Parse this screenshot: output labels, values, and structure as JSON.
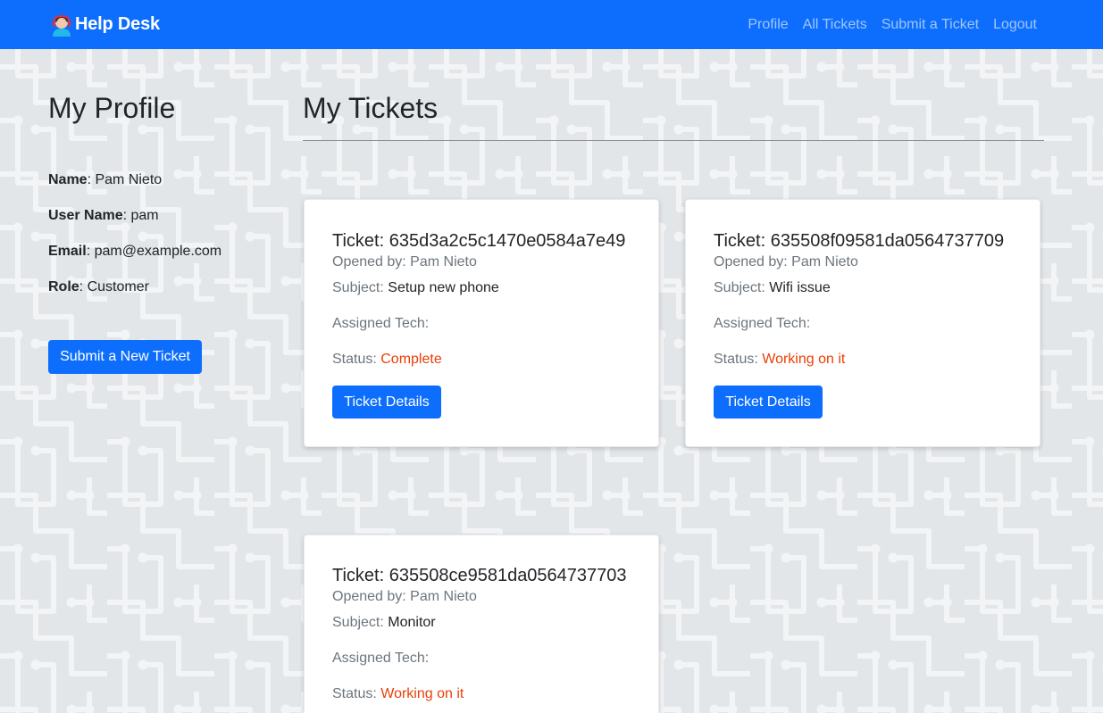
{
  "navbar": {
    "brand": "Help Desk",
    "links": [
      "Profile",
      "All Tickets",
      "Submit a Ticket",
      "Logout"
    ]
  },
  "profile": {
    "title": "My Profile",
    "fields": [
      {
        "label": "Name",
        "value": ": Pam Nieto"
      },
      {
        "label": "User Name",
        "value": ": pam"
      },
      {
        "label": "Email",
        "value": ": pam@example.com"
      },
      {
        "label": "Role",
        "value": ": Customer"
      }
    ],
    "submit_button": "Submit a New Ticket"
  },
  "tickets": {
    "title": "My Tickets",
    "subject_label": "Subject: ",
    "tech_label": "Assigned Tech:",
    "status_label": "Status: ",
    "details_button": "Ticket Details",
    "status_color": "#ea3f06",
    "items": [
      {
        "title": "Ticket: 635d3a2c5c1470e0584a7e49",
        "opened_by": "Opened by: Pam Nieto",
        "subject": "Setup new phone",
        "status": "Complete"
      },
      {
        "title": "Ticket: 635508f09581da0564737709",
        "opened_by": "Opened by: Pam Nieto",
        "subject": "Wifi issue",
        "status": "Working on it"
      },
      {
        "title": "Ticket: 635508ce9581da0564737703",
        "opened_by": "Opened by: Pam Nieto",
        "subject": "Monitor",
        "status": "Working on it"
      }
    ]
  },
  "colors": {
    "navbar": "#0d6efd",
    "button": "#0d6efd",
    "background": "#e3e6e9"
  },
  "icons": {
    "brand": "help-desk-agent-icon"
  }
}
